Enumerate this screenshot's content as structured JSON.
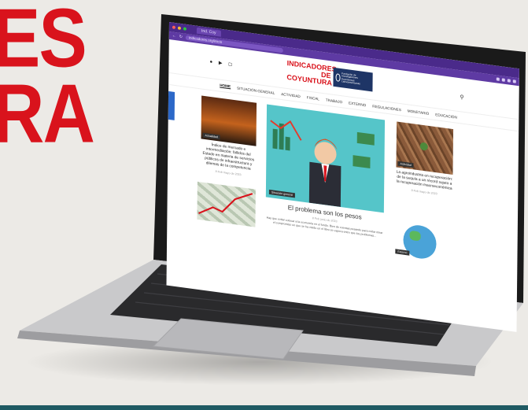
{
  "background_text": {
    "line1": "ES",
    "line2": "RA"
  },
  "browser": {
    "tab_title": "Ind. Coy",
    "url": "indicadores.org/inicio"
  },
  "site": {
    "social_icons": [
      "twitter-icon",
      "youtube-icon",
      "instagram-icon"
    ],
    "logo_line1": "INDICADORES",
    "logo_line2": "DE COYUNTURA",
    "logo_sub": "Fundación de Investigaciones Económicas Latinoamericanas"
  },
  "nav": {
    "items": [
      "HOME",
      "SITUACIÓN GENERAL",
      "ACTIVIDAD",
      "FISCAL",
      "TRABAJO",
      "EXTERNO",
      "REGULACIONES",
      "MONETARIO",
      "EDUCACIÓN"
    ]
  },
  "posts": {
    "left_top": {
      "badge": "Actualidad",
      "title": "Índice de mercado e intermediación: fallidos del Estado en materia de servicios públicos de infraestructura y dilemas de la competencia",
      "date": "8 Feb mayo de 2023"
    },
    "main": {
      "badge": "Situación general",
      "title": "El problema son los pesos",
      "date": "8 Feb junio de 2023",
      "excerpt": "Hay que evitar colocar a la economía en el fondo. Bien de cuentas pesando para evitar mirar el compromiso en que se ha vivido en el libro se espera entre que los problemas..."
    },
    "right_top": {
      "badge": "Actividad",
      "title": "La agroindustria en recuperación: de la sequía a un récord sujeto a la recuperación macroeconómica",
      "date": "8 Feb mayo de 2023"
    },
    "right_bottom": {
      "badge": "Externo"
    }
  },
  "colors": {
    "brand_red": "#d9131c",
    "browser_purple": "#4a2a8a",
    "logo_navy": "#1e3566",
    "share_blue": "#2c68c8",
    "footer_teal": "#1f5a63"
  }
}
